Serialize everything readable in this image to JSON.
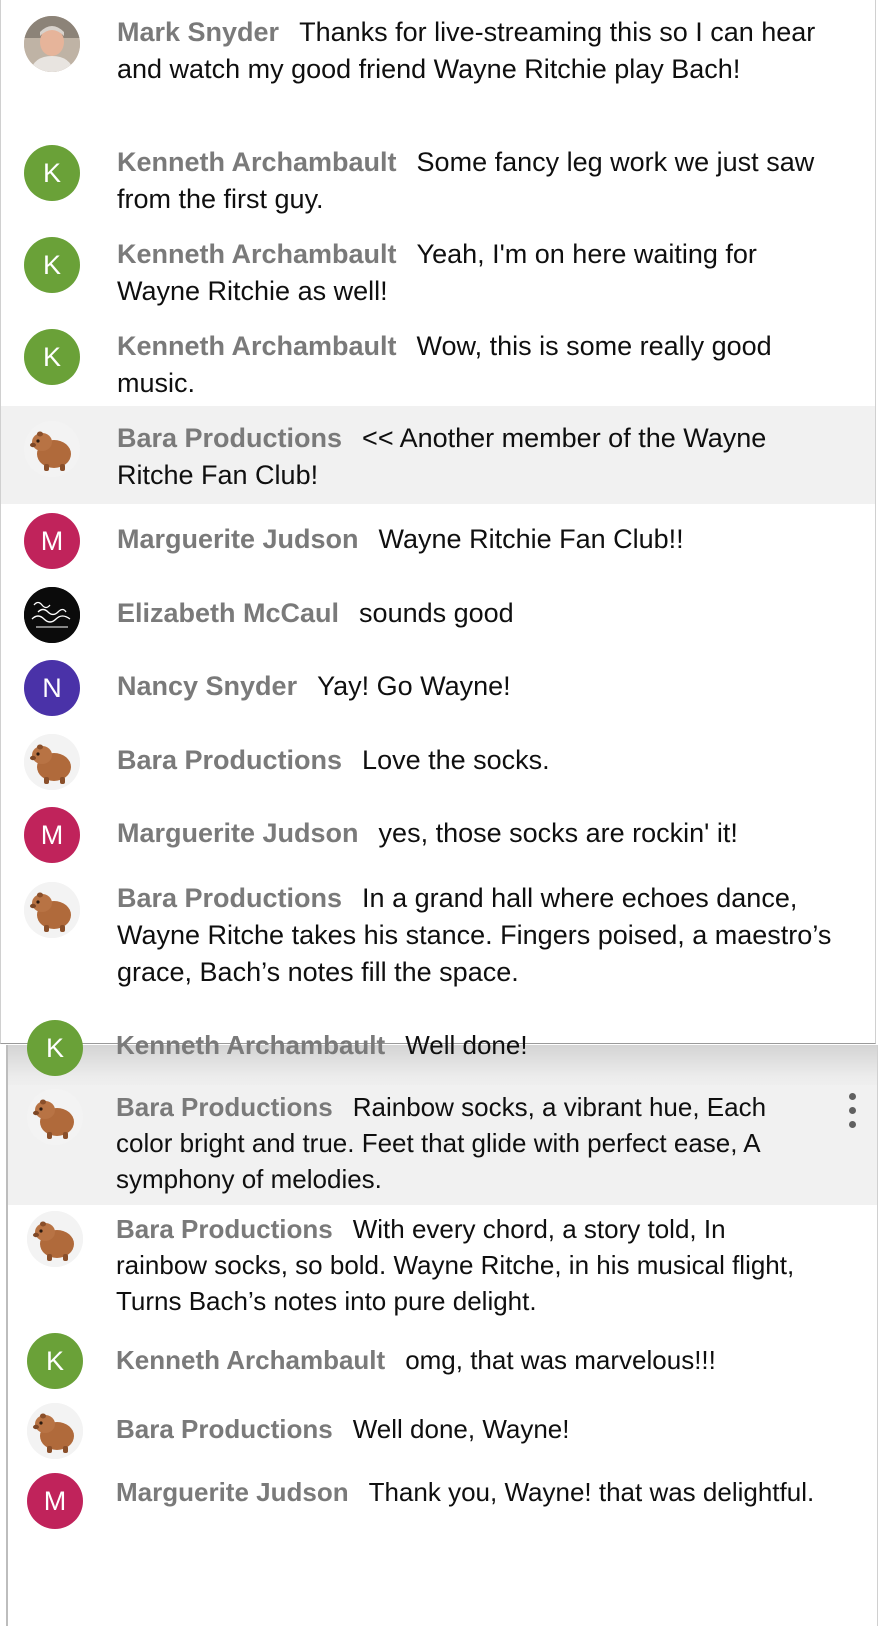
{
  "chat": {
    "top_messages": [
      {
        "author": "Mark Snyder",
        "text": "Thanks for live-streaming this so I can hear and watch my good friend Wayne Ritchie play Bach!",
        "avatar": {
          "type": "photo",
          "icon": "profile-photo"
        }
      },
      {
        "author": "Kenneth Archambault",
        "text": "Some fancy leg work we just saw from the first guy.",
        "avatar": {
          "type": "letter",
          "letter": "K",
          "color": "#6aa138"
        }
      },
      {
        "author": "Kenneth Archambault",
        "text": "Yeah, I'm on here waiting for Wayne Ritchie as well!",
        "avatar": {
          "type": "letter",
          "letter": "K",
          "color": "#6aa138"
        }
      },
      {
        "author": "Kenneth Archambault",
        "text": "Wow, this is some really good music.",
        "avatar": {
          "type": "letter",
          "letter": "K",
          "color": "#6aa138"
        }
      },
      {
        "author": "Bara Productions",
        "text": "<< Another member of the Wayne Ritche Fan Club!",
        "avatar": {
          "type": "capybara",
          "icon": "capybara-icon"
        },
        "highlighted": true
      },
      {
        "author": "Marguerite Judson",
        "text": "Wayne Ritchie Fan Club!!",
        "avatar": {
          "type": "letter",
          "letter": "M",
          "color": "#c0235b"
        }
      },
      {
        "author": "Elizabeth McCaul",
        "text": "sounds good",
        "avatar": {
          "type": "image",
          "icon": "handwriting-logo"
        }
      },
      {
        "author": "Nancy Snyder",
        "text": "Yay! Go Wayne!",
        "avatar": {
          "type": "letter",
          "letter": "N",
          "color": "#4a32a8"
        }
      },
      {
        "author": "Bara Productions",
        "text": "Love the socks.",
        "avatar": {
          "type": "capybara",
          "icon": "capybara-icon"
        }
      },
      {
        "author": "Marguerite Judson",
        "text": "yes, those socks are rockin' it!",
        "avatar": {
          "type": "letter",
          "letter": "M",
          "color": "#c0235b"
        }
      },
      {
        "author": "Bara Productions",
        "text": "In a grand hall where echoes dance, Wayne Ritche takes his stance. Fingers poised, a maestro’s grace, Bach’s notes fill the space.",
        "avatar": {
          "type": "capybara",
          "icon": "capybara-icon"
        }
      }
    ],
    "bottom_messages": [
      {
        "author": "Kenneth Archambault",
        "text": "Well done!",
        "avatar": {
          "type": "letter",
          "letter": "K",
          "color": "#6aa138"
        }
      },
      {
        "author": "Bara Productions",
        "text": "Rainbow socks, a vibrant hue, Each color bright and true. Feet that glide with perfect ease, A symphony of melodies.",
        "avatar": {
          "type": "capybara",
          "icon": "capybara-icon"
        },
        "highlighted": true,
        "menu_icon": "more-vert-icon"
      },
      {
        "author": "Bara Productions",
        "text": "With every chord, a story told, In rainbow socks, so bold. Wayne Ritche, in his musical flight, Turns Bach’s notes into pure delight.",
        "avatar": {
          "type": "capybara",
          "icon": "capybara-icon"
        }
      },
      {
        "author": "Kenneth Archambault",
        "text": "omg, that was marvelous!!!",
        "avatar": {
          "type": "letter",
          "letter": "K",
          "color": "#6aa138"
        }
      },
      {
        "author": "Bara Productions",
        "text": "Well done, Wayne!",
        "avatar": {
          "type": "capybara",
          "icon": "capybara-icon"
        }
      },
      {
        "author": "Marguerite Judson",
        "text": "Thank you, Wayne! that was delightful.",
        "avatar": {
          "type": "letter",
          "letter": "M",
          "color": "#c0235b"
        }
      }
    ]
  }
}
